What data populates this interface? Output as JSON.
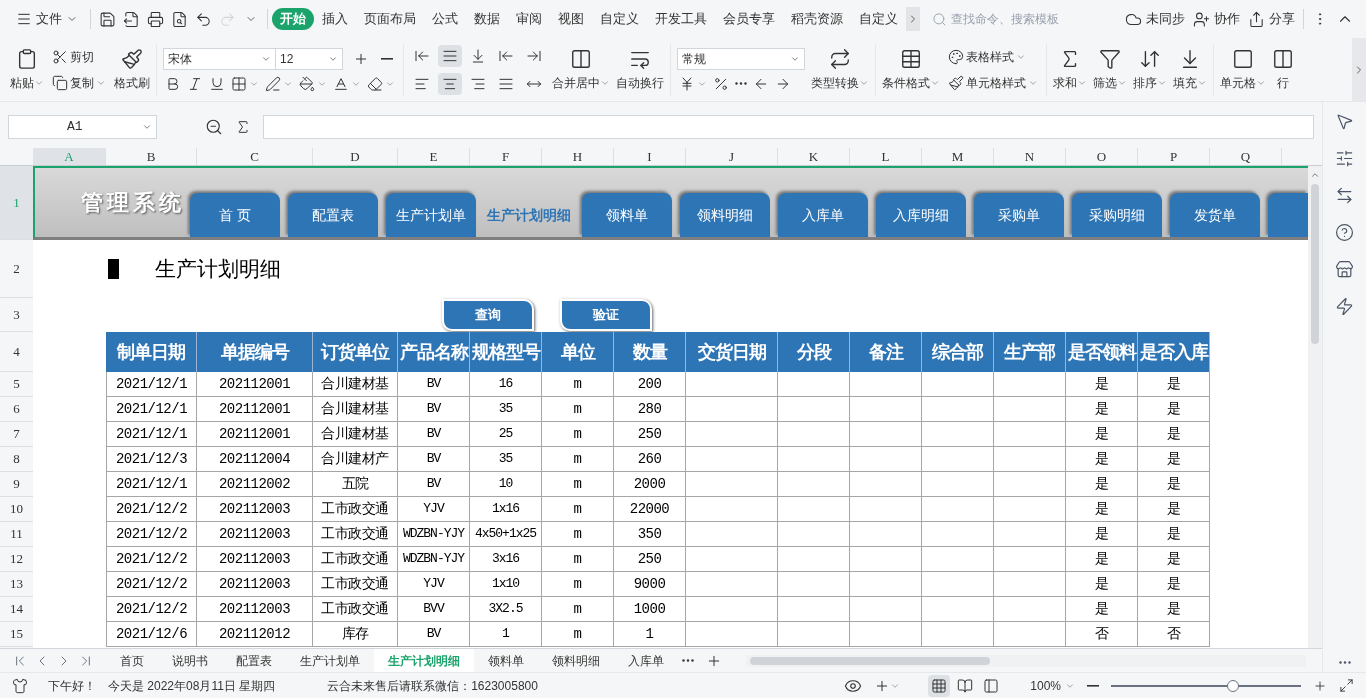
{
  "menubar": {
    "file_menu": "文件",
    "tabs": [
      {
        "label": "开始",
        "selected": true
      },
      {
        "label": "插入",
        "selected": false
      },
      {
        "label": "页面布局",
        "selected": false
      },
      {
        "label": "公式",
        "selected": false
      },
      {
        "label": "数据",
        "selected": false
      },
      {
        "label": "审阅",
        "selected": false
      },
      {
        "label": "视图",
        "selected": false
      },
      {
        "label": "自定义",
        "selected": false
      },
      {
        "label": "开发工具",
        "selected": false
      },
      {
        "label": "会员专享",
        "selected": false
      },
      {
        "label": "稻壳资源",
        "selected": false
      },
      {
        "label": "自定义",
        "selected": false
      }
    ],
    "search_placeholder": "查找命令、搜索模板",
    "actions": [
      "未同步",
      "协作",
      "分享"
    ]
  },
  "ribbon": {
    "paste": "粘贴",
    "cut": "剪切",
    "copy": "复制",
    "format_painter": "格式刷",
    "font": "宋体",
    "font_size": "12",
    "vertical_align": [
      {
        "selected": false
      },
      {
        "selected": true
      },
      {
        "selected": false
      }
    ],
    "horizontal_align": [
      {
        "selected": false
      },
      {
        "selected": true
      },
      {
        "selected": false
      },
      {
        "selected": false
      }
    ],
    "merge": "合并居中",
    "wrap": "自动换行",
    "number_format": "常规",
    "convert": "类型转换",
    "conditional_format": "条件格式",
    "table_style": "表格样式",
    "cell_style": "单元格样式",
    "sum": "求和",
    "filter": "筛选",
    "sort": "排序",
    "fill": "填充",
    "cell": "单元格",
    "row_col": "行"
  },
  "name_box": "A1",
  "columns": [
    {
      "label": "A",
      "selected": true
    },
    {
      "label": "B",
      "selected": false
    },
    {
      "label": "C",
      "selected": false
    },
    {
      "label": "D",
      "selected": false
    },
    {
      "label": "E",
      "selected": false
    },
    {
      "label": "F",
      "selected": false
    },
    {
      "label": "H",
      "selected": false
    },
    {
      "label": "I",
      "selected": false
    },
    {
      "label": "J",
      "selected": false
    },
    {
      "label": "K",
      "selected": false
    },
    {
      "label": "L",
      "selected": false
    },
    {
      "label": "M",
      "selected": false
    },
    {
      "label": "N",
      "selected": false
    },
    {
      "label": "O",
      "selected": false
    },
    {
      "label": "P",
      "selected": false
    },
    {
      "label": "Q",
      "selected": false
    }
  ],
  "row_numbers": [
    {
      "label": "1",
      "selected": true
    },
    {
      "label": "2",
      "selected": false
    },
    {
      "label": "3",
      "selected": false
    },
    {
      "label": "4",
      "selected": false
    },
    {
      "label": "5",
      "selected": false
    },
    {
      "label": "6",
      "selected": false
    },
    {
      "label": "7",
      "selected": false
    },
    {
      "label": "8",
      "selected": false
    },
    {
      "label": "9",
      "selected": false
    },
    {
      "label": "10",
      "selected": false
    },
    {
      "label": "11",
      "selected": false
    },
    {
      "label": "12",
      "selected": false
    },
    {
      "label": "13",
      "selected": false
    },
    {
      "label": "14",
      "selected": false
    },
    {
      "label": "15",
      "selected": false
    }
  ],
  "banner": {
    "title": "管理系统",
    "nav": [
      {
        "label": "首 页",
        "selected": false
      },
      {
        "label": "配置表",
        "selected": false
      },
      {
        "label": "生产计划单",
        "selected": false
      },
      {
        "label": "生产计划明细",
        "selected": true
      },
      {
        "label": "领料单",
        "selected": false
      },
      {
        "label": "领料明细",
        "selected": false
      },
      {
        "label": "入库单",
        "selected": false
      },
      {
        "label": "入库明细",
        "selected": false
      },
      {
        "label": "采购单",
        "selected": false
      },
      {
        "label": "采购明细",
        "selected": false
      },
      {
        "label": "发货单",
        "selected": false
      }
    ]
  },
  "heading": "生产计划明细",
  "buttons": [
    "查询",
    "验证"
  ],
  "table": {
    "columns": [
      "制单日期",
      "单据编号",
      "订货单位",
      "产品名称",
      "规格型号",
      "单位",
      "数量",
      "交货日期",
      "分段",
      "备注",
      "综合部",
      "生产部",
      "是否领料",
      "是否入库"
    ],
    "rows": [
      {
        "date": "2021/12/1",
        "number": "202112001",
        "customer": "合川建材基",
        "product": "BV",
        "spec": "16",
        "unit": "m",
        "qty": "200",
        "picked": "是",
        "stocked": "是"
      },
      {
        "date": "2021/12/1",
        "number": "202112001",
        "customer": "合川建材基",
        "product": "BV",
        "spec": "35",
        "unit": "m",
        "qty": "280",
        "picked": "是",
        "stocked": "是"
      },
      {
        "date": "2021/12/1",
        "number": "202112001",
        "customer": "合川建材基",
        "product": "BV",
        "spec": "25",
        "unit": "m",
        "qty": "250",
        "picked": "是",
        "stocked": "是"
      },
      {
        "date": "2021/12/3",
        "number": "202112004",
        "customer": "合川建材产",
        "product": "BV",
        "spec": "35",
        "unit": "m",
        "qty": "260",
        "picked": "是",
        "stocked": "是"
      },
      {
        "date": "2021/12/1",
        "number": "202112002",
        "customer": "五院",
        "product": "BV",
        "spec": "10",
        "unit": "m",
        "qty": "2000",
        "picked": "是",
        "stocked": "是"
      },
      {
        "date": "2021/12/2",
        "number": "202112003",
        "customer": "工市政交通",
        "product": "YJV",
        "spec": "1x16",
        "unit": "m",
        "qty": "22000",
        "picked": "是",
        "stocked": "是"
      },
      {
        "date": "2021/12/2",
        "number": "202112003",
        "customer": "工市政交通",
        "product": "WDZBN-YJY",
        "spec": "4x50+1x25",
        "unit": "m",
        "qty": "350",
        "picked": "是",
        "stocked": "是"
      },
      {
        "date": "2021/12/2",
        "number": "202112003",
        "customer": "工市政交通",
        "product": "WDZBN-YJY",
        "spec": "3x16",
        "unit": "m",
        "qty": "250",
        "picked": "是",
        "stocked": "是"
      },
      {
        "date": "2021/12/2",
        "number": "202112003",
        "customer": "工市政交通",
        "product": "YJV",
        "spec": "1x10",
        "unit": "m",
        "qty": "9000",
        "picked": "是",
        "stocked": "是"
      },
      {
        "date": "2021/12/2",
        "number": "202112003",
        "customer": "工市政交通",
        "product": "BVV",
        "spec": "3X2.5",
        "unit": "m",
        "qty": "1000",
        "picked": "是",
        "stocked": "是"
      },
      {
        "date": "2021/12/6",
        "number": "202112012",
        "customer": "库存",
        "product": "BV",
        "spec": "1",
        "unit": "m",
        "qty": "1",
        "picked": "否",
        "stocked": "否"
      }
    ]
  },
  "sheet_tabs": [
    {
      "label": "首页",
      "selected": false
    },
    {
      "label": "说明书",
      "selected": false
    },
    {
      "label": "配置表",
      "selected": false
    },
    {
      "label": "生产计划单",
      "selected": false
    },
    {
      "label": "生产计划明细",
      "selected": true
    },
    {
      "label": "领料单",
      "selected": false
    },
    {
      "label": "领料明细",
      "selected": false
    },
    {
      "label": "入库单",
      "selected": false
    }
  ],
  "status_bar": {
    "greeting": "下午好！",
    "date": "今天是 2022年08月11日 星期四",
    "notice": "云合未来售后请联系微信：1623005800",
    "views": [
      {
        "selected": true
      },
      {
        "selected": false
      },
      {
        "selected": false
      }
    ],
    "zoom": "100%",
    "zoom_slider": {
      "level": 0.64
    }
  }
}
